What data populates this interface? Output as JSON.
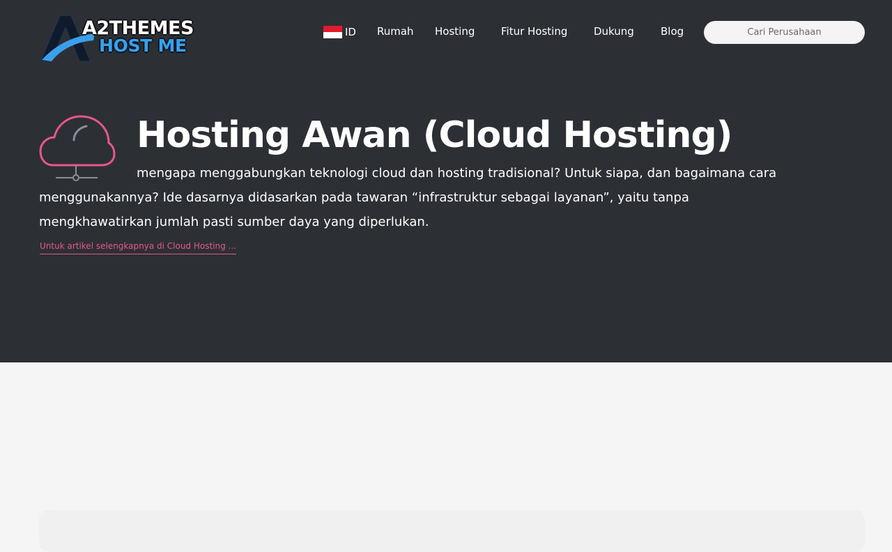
{
  "brand": {
    "logo_line1": "A2THEMES",
    "logo_line2": "HOST ME",
    "colors": {
      "primary_blue": "#3aa0ec",
      "dark": "#2c3035",
      "accent_pink": "#e8568a"
    }
  },
  "header": {
    "language": {
      "flag": "indonesia-flag-icon",
      "code": "ID"
    },
    "nav": [
      {
        "label": "Rumah"
      },
      {
        "label": "Hosting"
      },
      {
        "label": "Fitur Hosting"
      },
      {
        "label": "Dukung"
      },
      {
        "label": "Blog"
      }
    ],
    "search": {
      "placeholder": "Cari Perusahaan",
      "value": ""
    }
  },
  "hero": {
    "icon": "cloud-network-icon",
    "title": "Hosting Awan (Cloud Hosting)",
    "description": "mengapa menggabungkan teknologi cloud dan hosting tradisional? Untuk siapa, dan bagaimana cara menggunakannya? Ide dasarnya didasarkan pada tawaran “infrastruktur sebagai layanan”, yaitu tanpa mengkhawatirkan jumlah pasti sumber daya yang diperlukan.",
    "link_text": "Untuk artikel selengkapnya di Cloud Hosting ..."
  }
}
